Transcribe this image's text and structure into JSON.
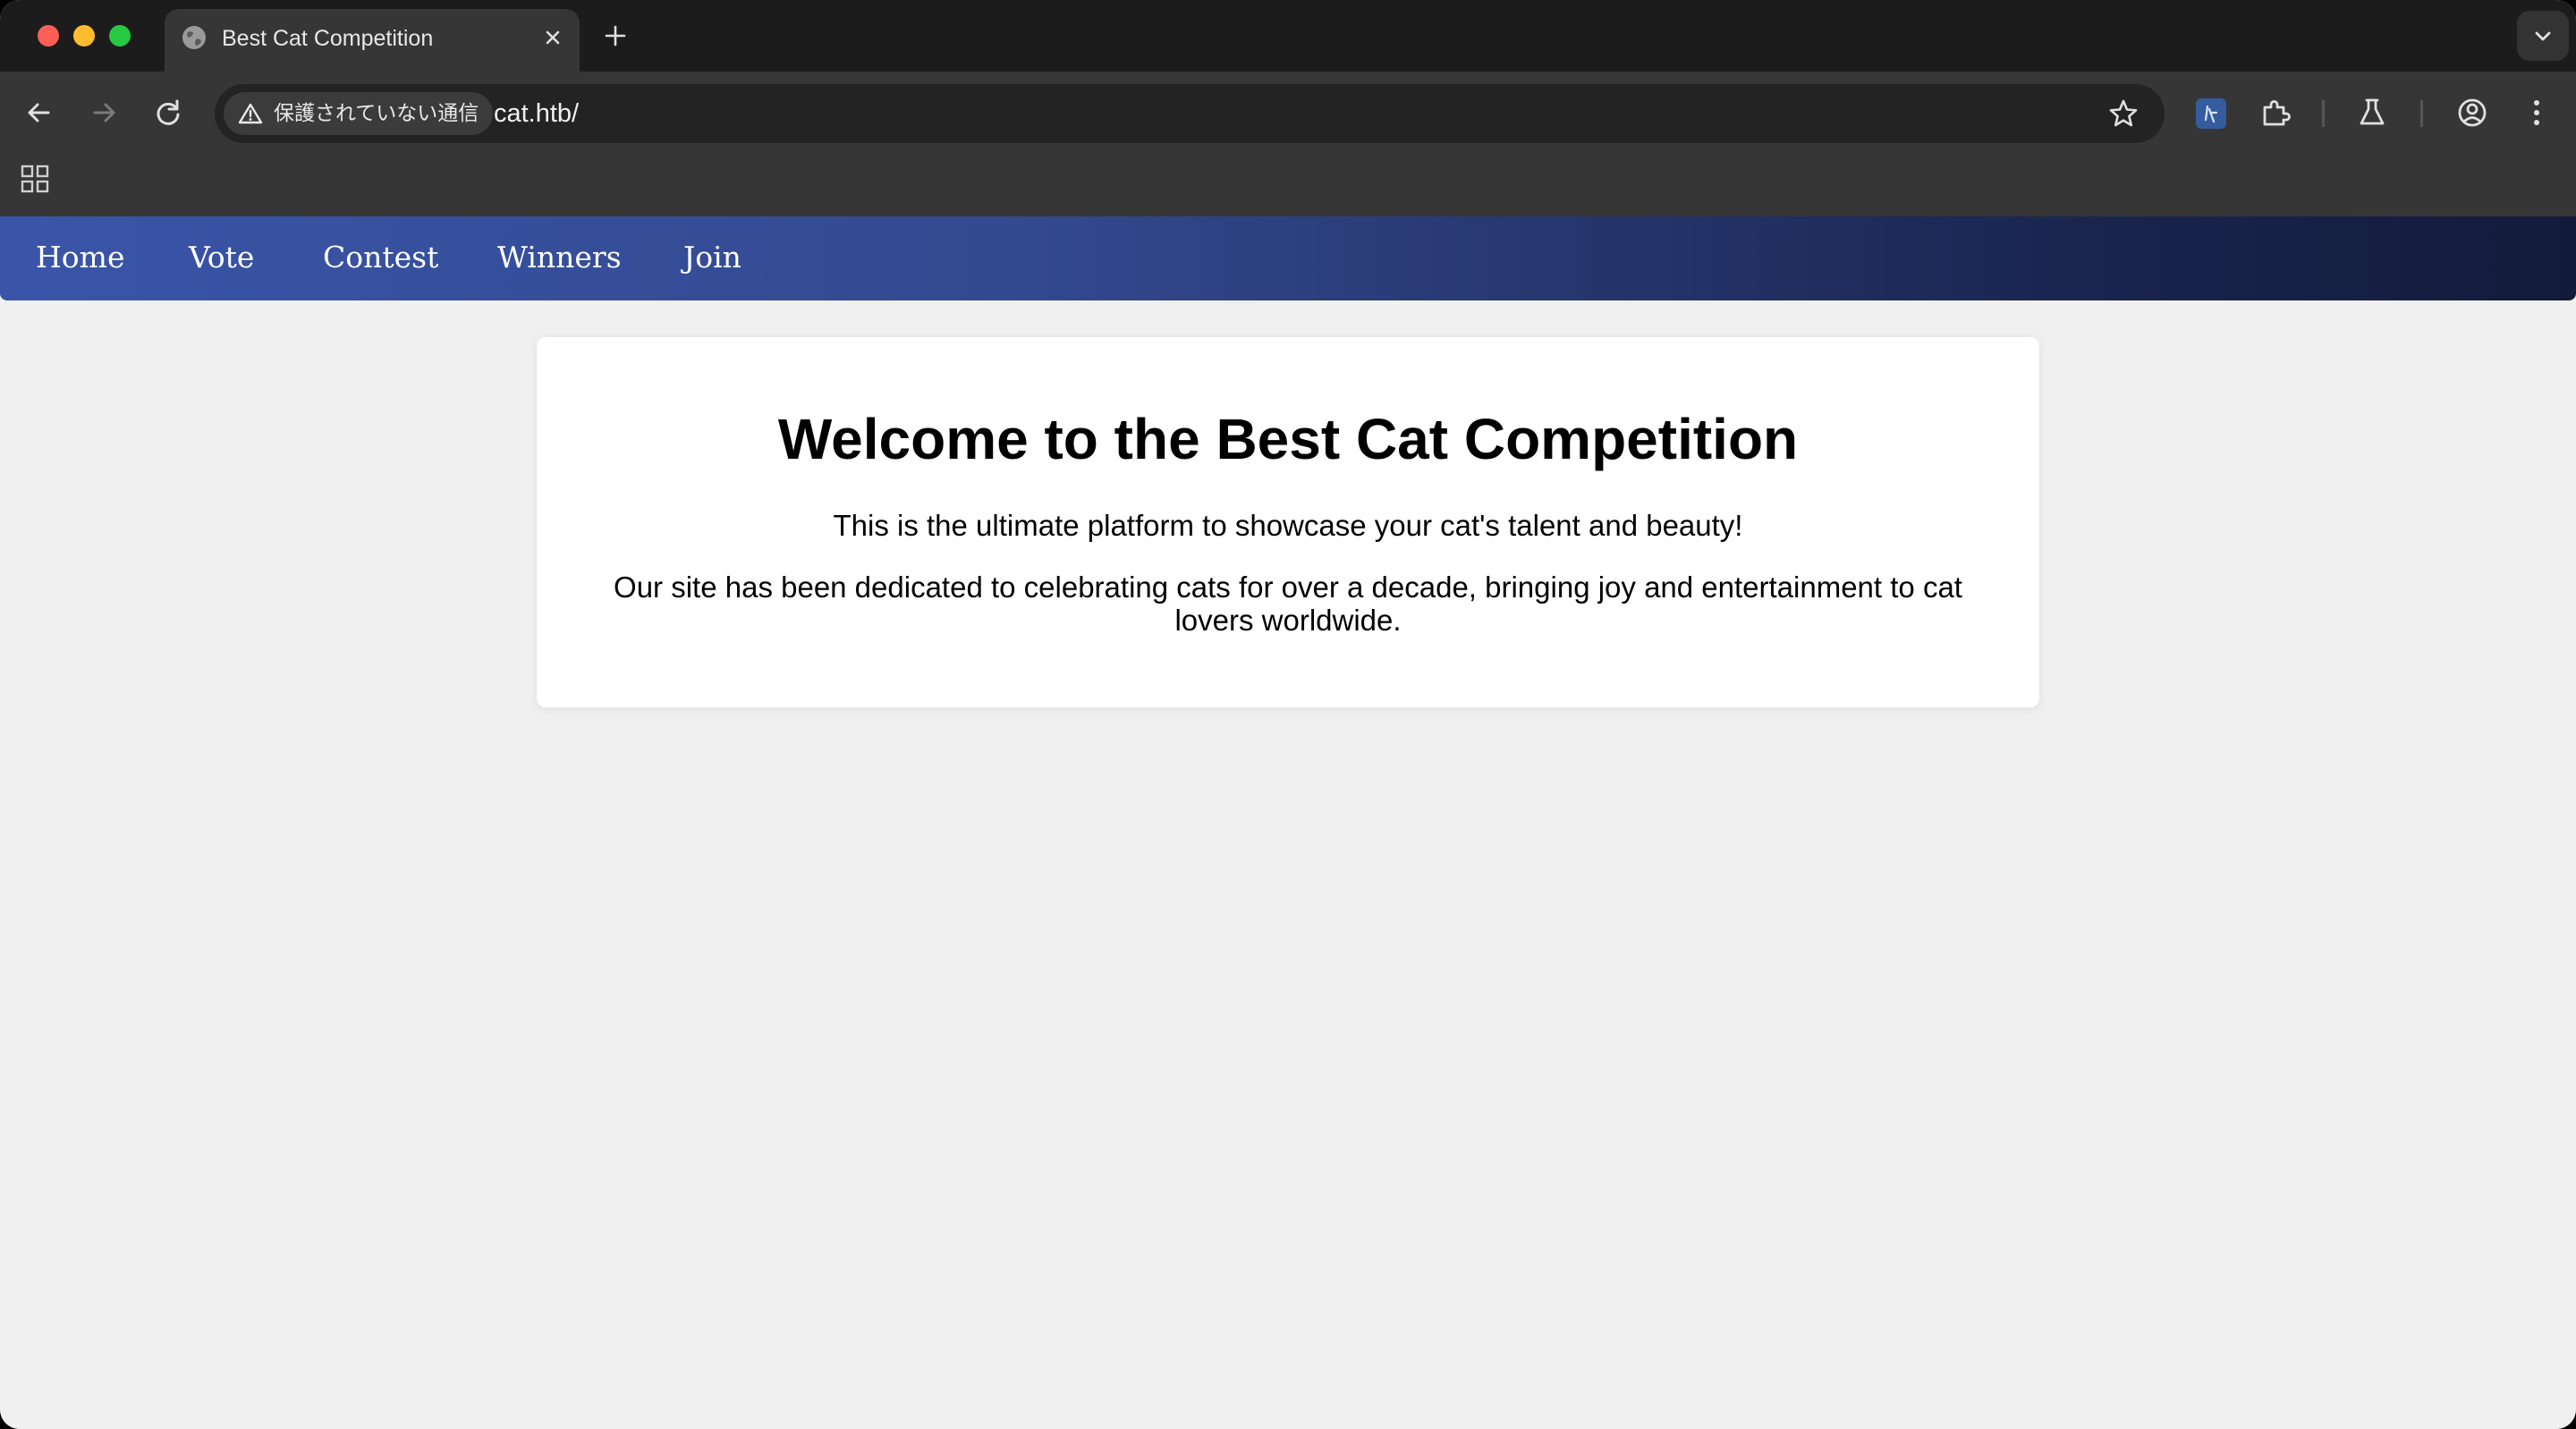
{
  "browser": {
    "tab": {
      "title": "Best Cat Competition"
    },
    "omnibox": {
      "security_label": "保護されていない通信",
      "url": "cat.htb/"
    },
    "extension_badge": "ﾞ"
  },
  "nav": {
    "items": [
      {
        "label": "Home"
      },
      {
        "label": "Vote"
      },
      {
        "label": "Contest"
      },
      {
        "label": "Winners"
      },
      {
        "label": "Join"
      }
    ]
  },
  "main": {
    "heading": "Welcome to the Best Cat Competition",
    "paragraphs": [
      "This is the ultimate platform to showcase your cat's talent and beauty!",
      "Our site has been dedicated to celebrating cats for over a decade, bringing joy and entertainment to cat lovers worldwide."
    ]
  },
  "colors": {
    "nav_gradient_start": "#3a55a8",
    "nav_gradient_end": "#131b3b",
    "page_background": "#f0f0f0",
    "card_background": "#ffffff"
  }
}
